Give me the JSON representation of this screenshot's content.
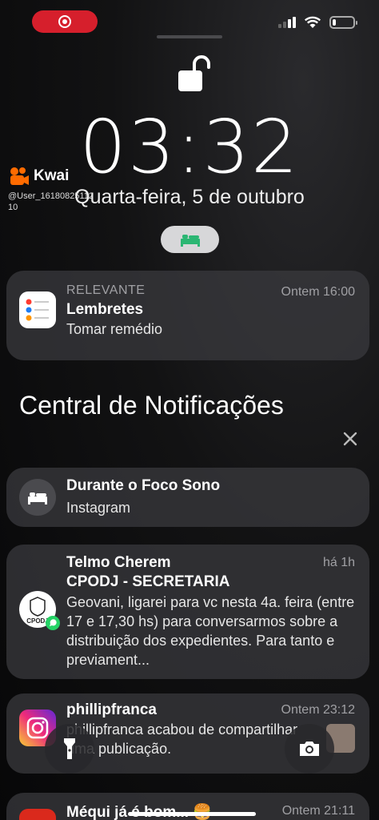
{
  "status_bar": {
    "signal_bars": 4,
    "signal_active": 2,
    "battery_level": 0.15,
    "record_icon": "screen-record-icon"
  },
  "lock_screen": {
    "lock_icon": "unlocked-padlock-icon",
    "time": "03:32",
    "date": "Quarta-feira, 5 de outubro",
    "focus_icon": "bed-icon",
    "focus_color": "#2bb673"
  },
  "watermark": {
    "brand": "Kwai",
    "user_line1": "@User_1618082511​2",
    "user_line2": "10",
    "brand_color": "#ff6b00"
  },
  "pinned_notification": {
    "category": "RELEVANTE",
    "app": "Lembretes",
    "body": "Tomar remédio",
    "time": "Ontem 16:00",
    "icon": "reminders-icon"
  },
  "notification_center": {
    "title": "Central de Notificações",
    "close_icon": "close-icon"
  },
  "notifications": [
    {
      "title": "Durante o Foco Sono",
      "body": "Instagram",
      "icon": "bed-icon"
    },
    {
      "title": "Telmo Cherem",
      "subtitle": "CPODJ - SECRETARIA",
      "body": "Geovani, ligarei para vc nesta 4a. feira (entre 17 e 17,30 hs) para conversarmos sobre a distribuição dos expedientes. Para tanto e previament...",
      "time": "há 1h",
      "icon": "whatsapp-icon",
      "avatar_text": "CPODJ"
    },
    {
      "title": "phillipfranca",
      "body": "phillipfranca acabou de compartilhar uma publicação.",
      "time": "Ontem 23:12",
      "icon": "instagram-icon"
    },
    {
      "title": "Méqui já é bom... 🍔",
      "time": "Ontem 21:11",
      "icon": "mcdonalds-icon"
    }
  ],
  "bottom_controls": {
    "flashlight_icon": "flashlight-icon",
    "camera_icon": "camera-icon"
  }
}
